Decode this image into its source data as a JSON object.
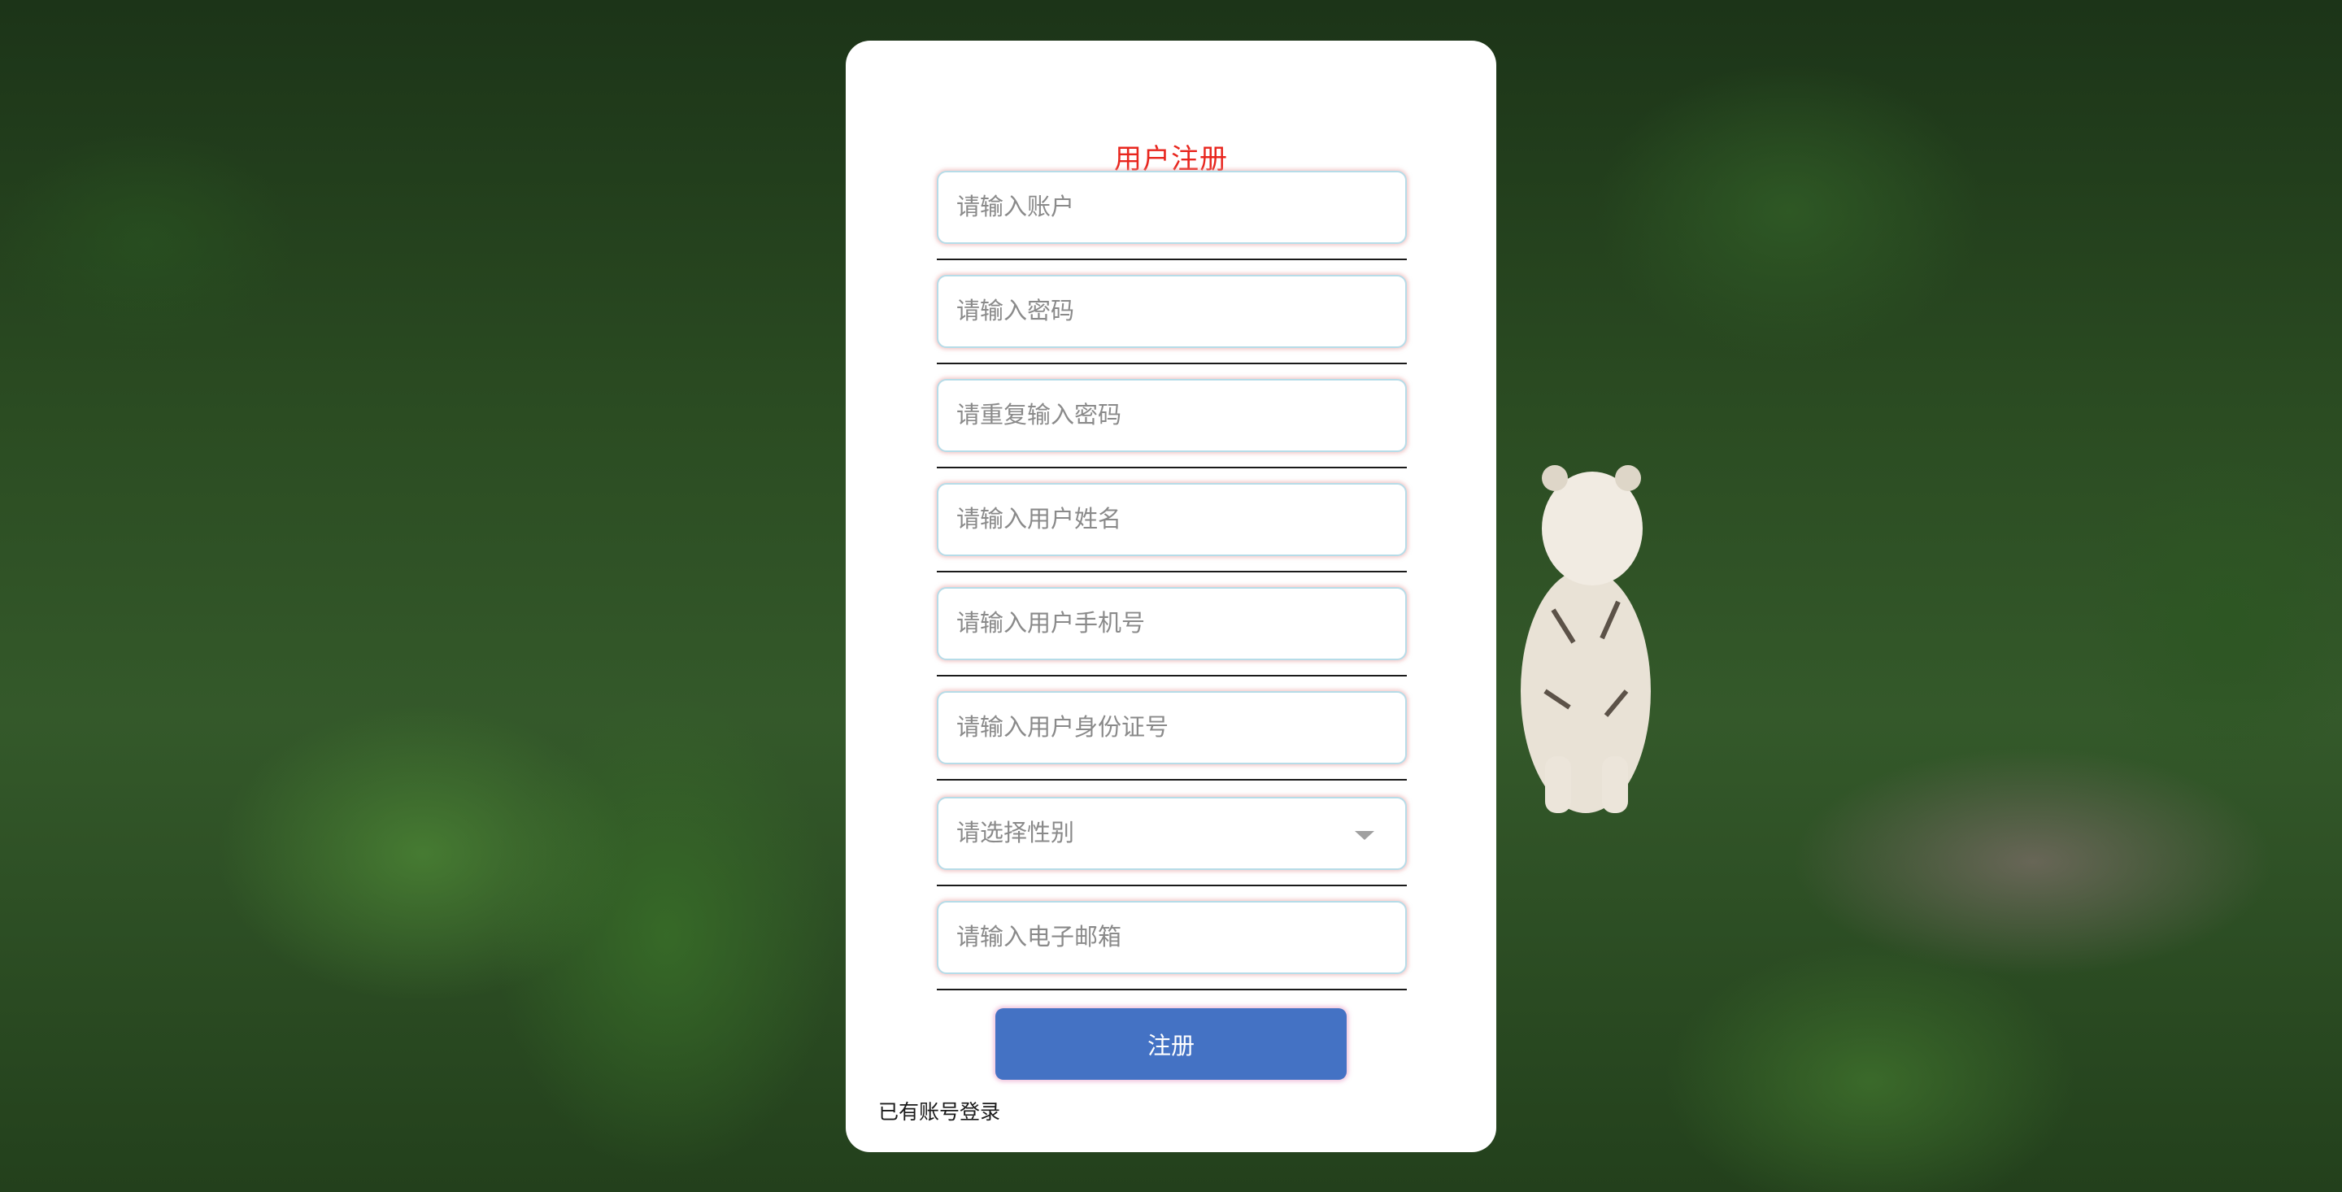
{
  "form": {
    "title": "用户注册",
    "fields": [
      {
        "placeholder": "请输入账户"
      },
      {
        "placeholder": "请输入密码"
      },
      {
        "placeholder": "请重复输入密码"
      },
      {
        "placeholder": "请输入用户姓名"
      },
      {
        "placeholder": "请输入用户手机号"
      },
      {
        "placeholder": "请输入用户身份证号"
      }
    ],
    "gender_select": {
      "selected": "请选择性别"
    },
    "email_field": {
      "placeholder": "请输入电子邮箱"
    },
    "submit_label": "注册",
    "login_link": "已有账号登录"
  }
}
